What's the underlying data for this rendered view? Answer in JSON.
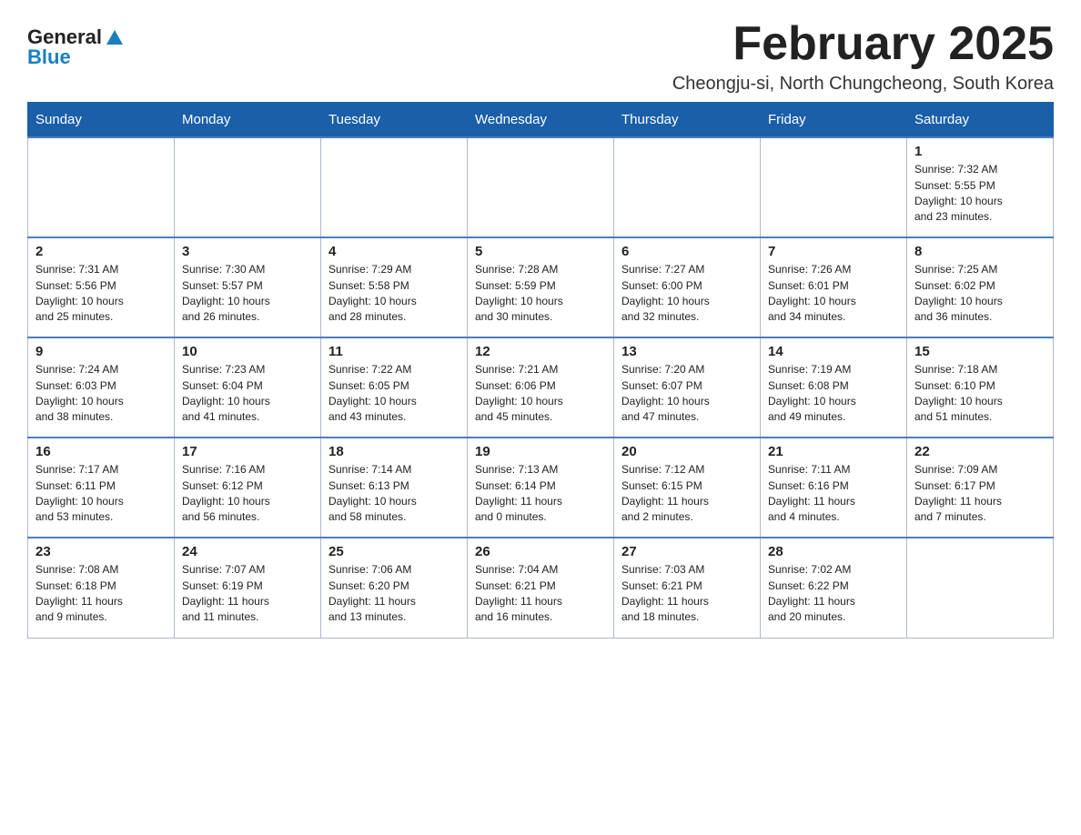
{
  "logo": {
    "general": "General",
    "blue": "Blue"
  },
  "title": "February 2025",
  "location": "Cheongju-si, North Chungcheong, South Korea",
  "days_of_week": [
    "Sunday",
    "Monday",
    "Tuesday",
    "Wednesday",
    "Thursday",
    "Friday",
    "Saturday"
  ],
  "weeks": [
    [
      {
        "day": "",
        "info": ""
      },
      {
        "day": "",
        "info": ""
      },
      {
        "day": "",
        "info": ""
      },
      {
        "day": "",
        "info": ""
      },
      {
        "day": "",
        "info": ""
      },
      {
        "day": "",
        "info": ""
      },
      {
        "day": "1",
        "info": "Sunrise: 7:32 AM\nSunset: 5:55 PM\nDaylight: 10 hours\nand 23 minutes."
      }
    ],
    [
      {
        "day": "2",
        "info": "Sunrise: 7:31 AM\nSunset: 5:56 PM\nDaylight: 10 hours\nand 25 minutes."
      },
      {
        "day": "3",
        "info": "Sunrise: 7:30 AM\nSunset: 5:57 PM\nDaylight: 10 hours\nand 26 minutes."
      },
      {
        "day": "4",
        "info": "Sunrise: 7:29 AM\nSunset: 5:58 PM\nDaylight: 10 hours\nand 28 minutes."
      },
      {
        "day": "5",
        "info": "Sunrise: 7:28 AM\nSunset: 5:59 PM\nDaylight: 10 hours\nand 30 minutes."
      },
      {
        "day": "6",
        "info": "Sunrise: 7:27 AM\nSunset: 6:00 PM\nDaylight: 10 hours\nand 32 minutes."
      },
      {
        "day": "7",
        "info": "Sunrise: 7:26 AM\nSunset: 6:01 PM\nDaylight: 10 hours\nand 34 minutes."
      },
      {
        "day": "8",
        "info": "Sunrise: 7:25 AM\nSunset: 6:02 PM\nDaylight: 10 hours\nand 36 minutes."
      }
    ],
    [
      {
        "day": "9",
        "info": "Sunrise: 7:24 AM\nSunset: 6:03 PM\nDaylight: 10 hours\nand 38 minutes."
      },
      {
        "day": "10",
        "info": "Sunrise: 7:23 AM\nSunset: 6:04 PM\nDaylight: 10 hours\nand 41 minutes."
      },
      {
        "day": "11",
        "info": "Sunrise: 7:22 AM\nSunset: 6:05 PM\nDaylight: 10 hours\nand 43 minutes."
      },
      {
        "day": "12",
        "info": "Sunrise: 7:21 AM\nSunset: 6:06 PM\nDaylight: 10 hours\nand 45 minutes."
      },
      {
        "day": "13",
        "info": "Sunrise: 7:20 AM\nSunset: 6:07 PM\nDaylight: 10 hours\nand 47 minutes."
      },
      {
        "day": "14",
        "info": "Sunrise: 7:19 AM\nSunset: 6:08 PM\nDaylight: 10 hours\nand 49 minutes."
      },
      {
        "day": "15",
        "info": "Sunrise: 7:18 AM\nSunset: 6:10 PM\nDaylight: 10 hours\nand 51 minutes."
      }
    ],
    [
      {
        "day": "16",
        "info": "Sunrise: 7:17 AM\nSunset: 6:11 PM\nDaylight: 10 hours\nand 53 minutes."
      },
      {
        "day": "17",
        "info": "Sunrise: 7:16 AM\nSunset: 6:12 PM\nDaylight: 10 hours\nand 56 minutes."
      },
      {
        "day": "18",
        "info": "Sunrise: 7:14 AM\nSunset: 6:13 PM\nDaylight: 10 hours\nand 58 minutes."
      },
      {
        "day": "19",
        "info": "Sunrise: 7:13 AM\nSunset: 6:14 PM\nDaylight: 11 hours\nand 0 minutes."
      },
      {
        "day": "20",
        "info": "Sunrise: 7:12 AM\nSunset: 6:15 PM\nDaylight: 11 hours\nand 2 minutes."
      },
      {
        "day": "21",
        "info": "Sunrise: 7:11 AM\nSunset: 6:16 PM\nDaylight: 11 hours\nand 4 minutes."
      },
      {
        "day": "22",
        "info": "Sunrise: 7:09 AM\nSunset: 6:17 PM\nDaylight: 11 hours\nand 7 minutes."
      }
    ],
    [
      {
        "day": "23",
        "info": "Sunrise: 7:08 AM\nSunset: 6:18 PM\nDaylight: 11 hours\nand 9 minutes."
      },
      {
        "day": "24",
        "info": "Sunrise: 7:07 AM\nSunset: 6:19 PM\nDaylight: 11 hours\nand 11 minutes."
      },
      {
        "day": "25",
        "info": "Sunrise: 7:06 AM\nSunset: 6:20 PM\nDaylight: 11 hours\nand 13 minutes."
      },
      {
        "day": "26",
        "info": "Sunrise: 7:04 AM\nSunset: 6:21 PM\nDaylight: 11 hours\nand 16 minutes."
      },
      {
        "day": "27",
        "info": "Sunrise: 7:03 AM\nSunset: 6:21 PM\nDaylight: 11 hours\nand 18 minutes."
      },
      {
        "day": "28",
        "info": "Sunrise: 7:02 AM\nSunset: 6:22 PM\nDaylight: 11 hours\nand 20 minutes."
      },
      {
        "day": "",
        "info": ""
      }
    ]
  ]
}
